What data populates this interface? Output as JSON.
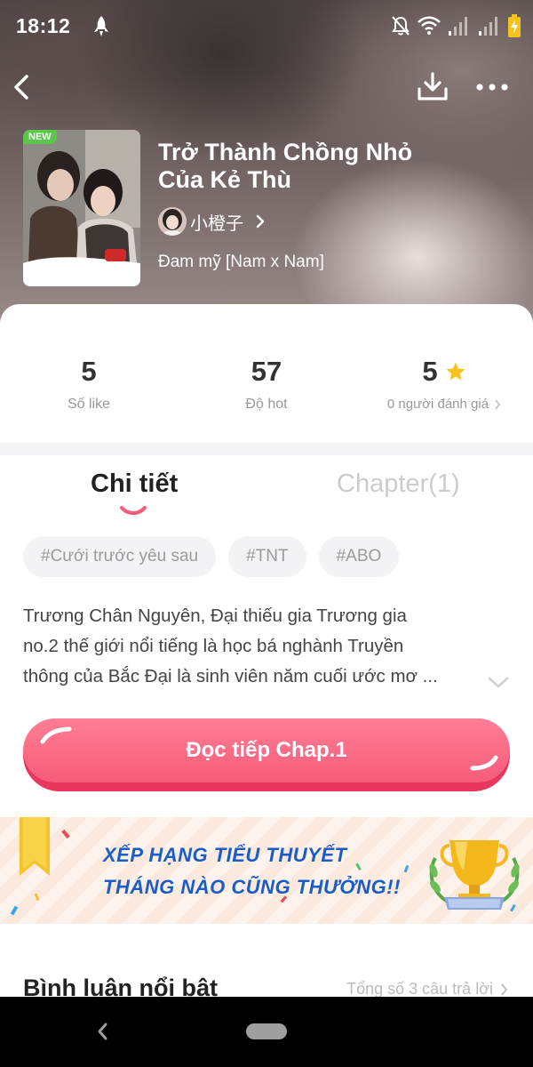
{
  "status_bar": {
    "time": "18:12",
    "icons": [
      "rocket-icon",
      "bell-off-icon",
      "wifi-icon",
      "signal-icon",
      "signal-icon",
      "battery-charging-icon"
    ]
  },
  "nav": {
    "back_icon": "chevron-left-icon",
    "download_icon": "download-icon",
    "more_icon": "more-horizontal-icon"
  },
  "book": {
    "new_badge": "NEW",
    "title_line1": "Trở Thành Chồng Nhỏ",
    "title_line2": "Của Kẻ Thù",
    "author": "小橙子",
    "genre": "Đam mỹ [Nam x Nam]"
  },
  "stats": {
    "likes": {
      "value": "5",
      "label": "Số like"
    },
    "hot": {
      "value": "57",
      "label": "Độ hot"
    },
    "rating": {
      "value": "5",
      "label": "0 người đánh giá"
    }
  },
  "tabs": {
    "detail": "Chi tiết",
    "chapter": "Chapter(1)",
    "active": "detail"
  },
  "tags": [
    "#Cưới trước yêu sau",
    "#TNT",
    "#ABO"
  ],
  "description": {
    "line1": "Trương Chân Nguyên, Đại thiếu gia Trương gia",
    "line2": "no.2 thế giới nổi tiếng là học bá nghành Truyền",
    "line3": "thông của Bắc Đại là sinh viên năm cuối ước mơ ..."
  },
  "read_button": {
    "label": "Đọc tiếp Chap.1"
  },
  "banner": {
    "line1": "XẾP HẠNG TIỂU THUYẾT",
    "line2": "THÁNG NÀO CŨNG THƯỞNG!!"
  },
  "comments": {
    "title": "Bình luận nổi bật",
    "count": "Tổng số 3 câu trả lời"
  },
  "colors": {
    "accent": "#f65c7a",
    "accent_dark": "#e8365f",
    "banner_text": "#1a5cc8",
    "star": "#f6c21c",
    "new_badge": "#5cc54c"
  }
}
